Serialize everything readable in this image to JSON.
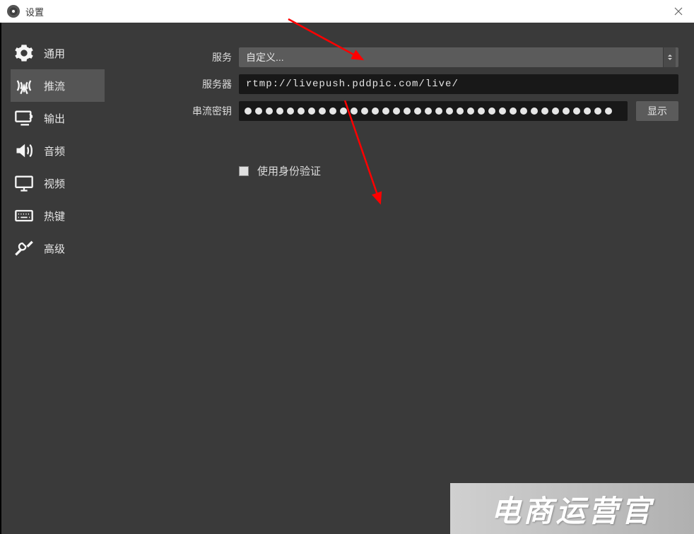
{
  "titlebar": {
    "title": "设置"
  },
  "sidebar": {
    "items": [
      {
        "label": "通用"
      },
      {
        "label": "推流"
      },
      {
        "label": "输出"
      },
      {
        "label": "音频"
      },
      {
        "label": "视频"
      },
      {
        "label": "热键"
      },
      {
        "label": "高级"
      }
    ],
    "active_index": 1
  },
  "form": {
    "service_label": "服务",
    "service_value": "自定义...",
    "server_label": "服务器",
    "server_value": "rtmp://livepush.pddpic.com/live/",
    "streamkey_label": "串流密钥",
    "streamkey_dot_count": 35,
    "show_label": "显示",
    "auth_checkbox_label": "使用身份验证",
    "auth_checked": false
  },
  "watermark": {
    "main": "电商运营官",
    "sub": ""
  },
  "colors": {
    "bg": "#3a3a3a",
    "panel": "#5b5b5b",
    "input_bg": "#181818",
    "arrow": "#ff0000"
  }
}
